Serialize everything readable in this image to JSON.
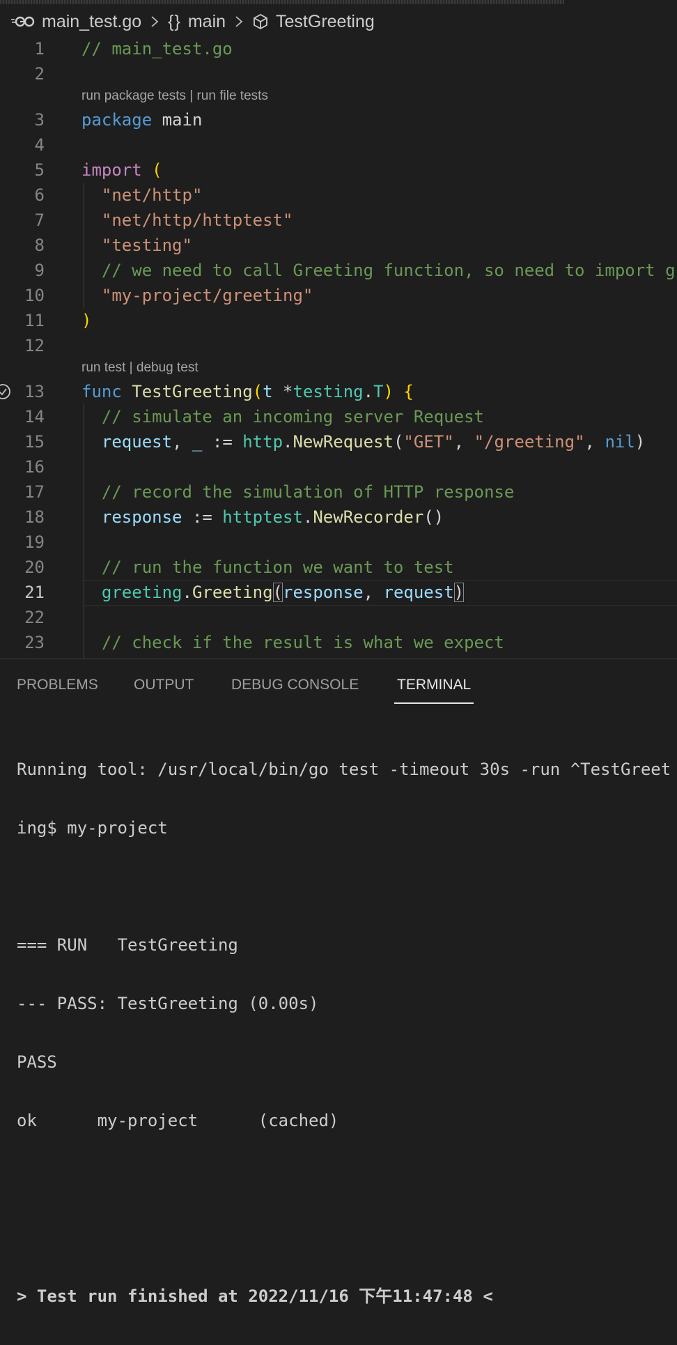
{
  "breadcrumb": {
    "file": "main_test.go",
    "braces": "{}",
    "scope": "main",
    "symbol": "TestGreeting"
  },
  "code_lens": {
    "run_package_tests": "run package tests",
    "separator": "|",
    "run_file_tests": "run file tests",
    "run_test": "run test",
    "debug_test": "debug test"
  },
  "editor": {
    "active_line": "21",
    "lines": [
      {
        "n": "1",
        "segs": [
          [
            "cm",
            "// main_test.go"
          ]
        ]
      },
      {
        "n": "2",
        "segs": []
      },
      {
        "n": "3",
        "segs": [
          [
            "kwb",
            "package"
          ],
          [
            "pl",
            " main"
          ]
        ]
      },
      {
        "n": "4",
        "segs": []
      },
      {
        "n": "5",
        "segs": [
          [
            "kw",
            "import"
          ],
          [
            "pl",
            " "
          ],
          [
            "par",
            "("
          ]
        ]
      },
      {
        "n": "6",
        "segs": [
          [
            "pl",
            "  "
          ],
          [
            "str",
            "\"net/http\""
          ]
        ]
      },
      {
        "n": "7",
        "segs": [
          [
            "pl",
            "  "
          ],
          [
            "str",
            "\"net/http/httptest\""
          ]
        ]
      },
      {
        "n": "8",
        "segs": [
          [
            "pl",
            "  "
          ],
          [
            "str",
            "\"testing\""
          ]
        ]
      },
      {
        "n": "9",
        "segs": [
          [
            "pl",
            "  "
          ],
          [
            "cm",
            "// we need to call Greeting function, so need to import g"
          ]
        ]
      },
      {
        "n": "10",
        "segs": [
          [
            "pl",
            "  "
          ],
          [
            "str",
            "\"my-project/greeting\""
          ]
        ]
      },
      {
        "n": "11",
        "segs": [
          [
            "par",
            ")"
          ]
        ]
      },
      {
        "n": "12",
        "segs": []
      },
      {
        "n": "13",
        "segs": [
          [
            "kwb",
            "func"
          ],
          [
            "pl",
            " "
          ],
          [
            "fn",
            "TestGreeting"
          ],
          [
            "par",
            "("
          ],
          [
            "vr",
            "t"
          ],
          [
            "pl",
            " *"
          ],
          [
            "ty",
            "testing"
          ],
          [
            "pl",
            "."
          ],
          [
            "ty",
            "T"
          ],
          [
            "par",
            ")"
          ],
          [
            "pl",
            " "
          ],
          [
            "par",
            "{"
          ]
        ]
      },
      {
        "n": "14",
        "segs": [
          [
            "pl",
            "  "
          ],
          [
            "cm",
            "// simulate an incoming server Request"
          ]
        ]
      },
      {
        "n": "15",
        "segs": [
          [
            "pl",
            "  "
          ],
          [
            "vr",
            "request"
          ],
          [
            "pl",
            ", "
          ],
          [
            "vr",
            "_"
          ],
          [
            "pl",
            " := "
          ],
          [
            "ty",
            "http"
          ],
          [
            "pl",
            "."
          ],
          [
            "fn",
            "NewRequest"
          ],
          [
            "pl",
            "("
          ],
          [
            "str",
            "\"GET\""
          ],
          [
            "pl",
            ", "
          ],
          [
            "str",
            "\"/greeting\""
          ],
          [
            "pl",
            ", "
          ],
          [
            "kwb",
            "nil"
          ],
          [
            "pl",
            ")"
          ]
        ]
      },
      {
        "n": "16",
        "segs": []
      },
      {
        "n": "17",
        "segs": [
          [
            "pl",
            "  "
          ],
          [
            "cm",
            "// record the simulation of HTTP response"
          ]
        ]
      },
      {
        "n": "18",
        "segs": [
          [
            "pl",
            "  "
          ],
          [
            "vr",
            "response"
          ],
          [
            "pl",
            " := "
          ],
          [
            "ty",
            "httptest"
          ],
          [
            "pl",
            "."
          ],
          [
            "fn",
            "NewRecorder"
          ],
          [
            "pl",
            "()"
          ]
        ]
      },
      {
        "n": "19",
        "segs": []
      },
      {
        "n": "20",
        "segs": [
          [
            "pl",
            "  "
          ],
          [
            "cm",
            "// run the function we want to test"
          ]
        ]
      },
      {
        "n": "21",
        "segs": [
          [
            "pl",
            "  "
          ],
          [
            "ty",
            "greeting"
          ],
          [
            "pl",
            "."
          ],
          [
            "fn",
            "Greeting"
          ],
          [
            "bm",
            "("
          ],
          [
            "vr",
            "response"
          ],
          [
            "pl",
            ", "
          ],
          [
            "vr",
            "request"
          ],
          [
            "bm",
            ")"
          ]
        ]
      },
      {
        "n": "22",
        "segs": []
      },
      {
        "n": "23",
        "segs": [
          [
            "pl",
            "  "
          ],
          [
            "cm",
            "// check if the result is what we expect"
          ]
        ]
      }
    ]
  },
  "panel": {
    "tabs": [
      "PROBLEMS",
      "OUTPUT",
      "DEBUG CONSOLE",
      "TERMINAL"
    ],
    "active_tab": "TERMINAL",
    "terminal": {
      "lines": [
        "Running tool: /usr/local/bin/go test -timeout 30s -run ^TestGreet",
        "ing$ my-project",
        "",
        "=== RUN   TestGreeting",
        "--- PASS: TestGreeting (0.00s)",
        "PASS",
        "ok      my-project      (cached)",
        "",
        ""
      ],
      "finish": "> Test run finished at 2022/11/16 下午11:47:48 <"
    }
  },
  "colors": {
    "background": "#1e1e1e",
    "comment": "#6a9955",
    "string": "#ce9178",
    "keyword": "#569cd6",
    "function": "#dcdcaa",
    "type": "#4ec9b0",
    "variable": "#9cdcfe"
  },
  "icons": [
    "go-file-icon",
    "chevron-right-icon",
    "cube-icon",
    "test-status-icon"
  ]
}
